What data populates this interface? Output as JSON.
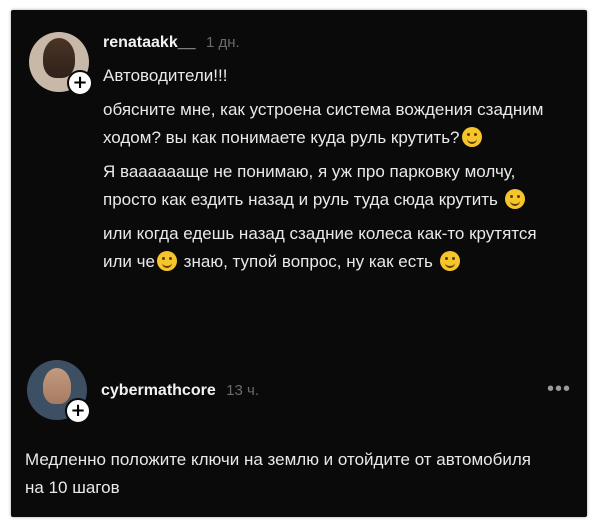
{
  "comments": [
    {
      "username": "renataakk__",
      "time": "1 дн.",
      "paragraphs": [
        "Автоводители!!!",
        "обясните мне, как устроена система вождения сзадним ходом? вы как понимаете куда руль крутить?",
        "Я вааааааще не понимаю, я уж про парковку молчу, просто как ездить назад и руль туда сюда крутить",
        "или когда едешь назад сзадние колеса как-то крутятся или че",
        " знаю, тупой вопрос, ну как есть"
      ]
    },
    {
      "username": "cybermathcore",
      "time": "13 ч.",
      "more": "•••",
      "text": "Медленно положите ключи на землю и отойдите от автомобиля на 10 шагов"
    }
  ],
  "plus_glyph": "+"
}
